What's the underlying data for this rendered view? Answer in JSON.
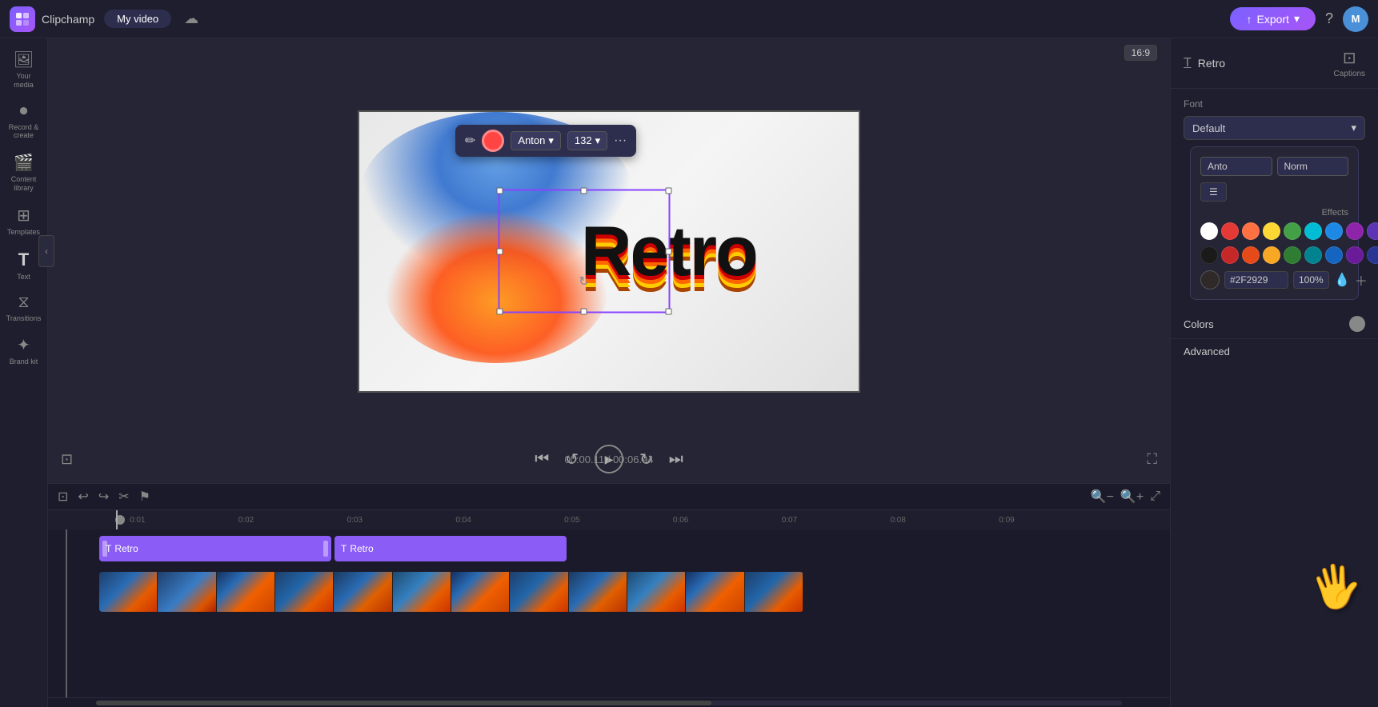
{
  "app": {
    "name": "Clipchamp",
    "title": "My video"
  },
  "topbar": {
    "logo_text": "C",
    "title": "Clipchamp",
    "video_tab": "My video",
    "export_label": "Export",
    "help_icon": "?",
    "avatar_initial": "M"
  },
  "sidebar": {
    "items": [
      {
        "id": "your-media",
        "icon": "🖼",
        "label": "Your media"
      },
      {
        "id": "record-create",
        "icon": "⏺",
        "label": "Record &\ncreate"
      },
      {
        "id": "content-library",
        "icon": "🎬",
        "label": "Content\nlibrary"
      },
      {
        "id": "templates",
        "icon": "⊞",
        "label": "Templates"
      },
      {
        "id": "text",
        "icon": "T",
        "label": "Text"
      },
      {
        "id": "transitions",
        "icon": "⧖",
        "label": "Transitions"
      },
      {
        "id": "brand-kit",
        "icon": "✦",
        "label": "Brand kit"
      }
    ]
  },
  "canvas": {
    "ratio": "16:9",
    "text_content": "Retro"
  },
  "text_toolbar": {
    "font_name": "Anton",
    "font_size": "132",
    "more_icon": "···"
  },
  "timeline": {
    "current_time": "00:00.11",
    "total_time": "00:06.94",
    "ruler_marks": [
      "0:01",
      "0:02",
      "0:03",
      "0:04",
      "0:05",
      "0:06",
      "0:07",
      "0:08",
      "0:09"
    ],
    "clips": [
      {
        "label": "Retro",
        "type": "text"
      },
      {
        "label": "Retro",
        "type": "text"
      }
    ]
  },
  "right_panel": {
    "style_title": "Retro",
    "captions_label": "Captions",
    "font_section_label": "Font",
    "font_default": "Default",
    "font_name_placeholder": "Anto",
    "style_placeholder": "Norm",
    "effects_label": "Effects",
    "colors_label": "Colors",
    "advanced_label": "Advanced",
    "hex_value": "#2F2929",
    "opacity_value": "100%",
    "color_swatches_row1": [
      "white",
      "red1",
      "orange1",
      "yellow1",
      "green1",
      "cyan1",
      "blue1",
      "purple1",
      "darkpurple"
    ],
    "color_swatches_row2": [
      "black",
      "red2",
      "orange2",
      "yellow2",
      "green2",
      "cyan2",
      "blue2",
      "purple2",
      "darkblue"
    ]
  }
}
